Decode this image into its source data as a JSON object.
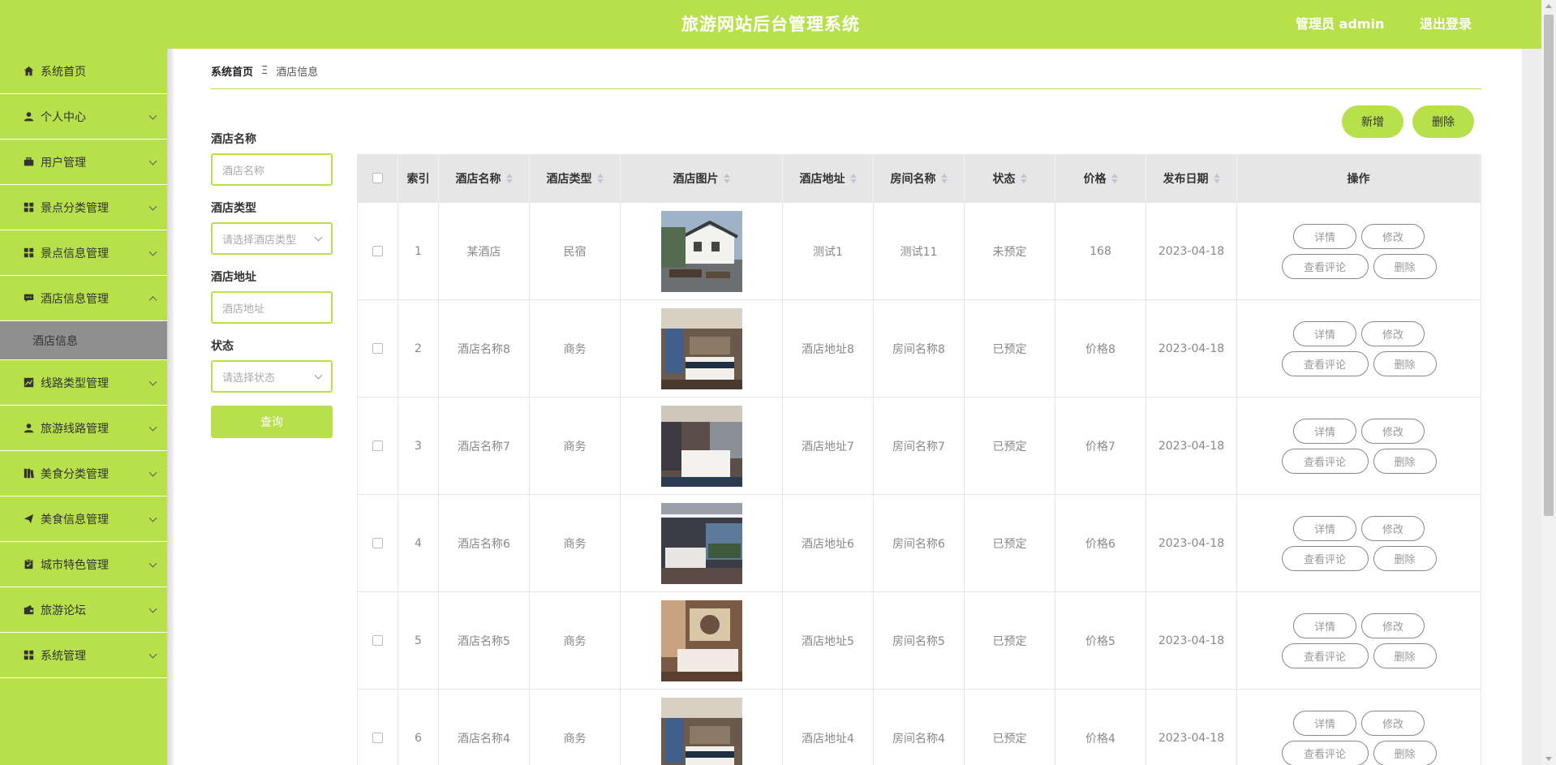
{
  "header": {
    "title": "旅游网站后台管理系统",
    "user": "管理员 admin",
    "logout": "退出登录"
  },
  "sidebar": {
    "items": [
      {
        "label": "系统首页",
        "icon": "home-icon"
      },
      {
        "label": "个人中心",
        "icon": "user-icon"
      },
      {
        "label": "用户管理",
        "icon": "briefcase-icon"
      },
      {
        "label": "景点分类管理",
        "icon": "grid-icon"
      },
      {
        "label": "景点信息管理",
        "icon": "grid-icon"
      },
      {
        "label": "酒店信息管理",
        "icon": "chat-icon"
      },
      {
        "label": "线路类型管理",
        "icon": "chart-icon"
      },
      {
        "label": "旅游线路管理",
        "icon": "user-icon"
      },
      {
        "label": "美食分类管理",
        "icon": "book-icon"
      },
      {
        "label": "美食信息管理",
        "icon": "send-icon"
      },
      {
        "label": "城市特色管理",
        "icon": "clipboard-icon"
      },
      {
        "label": "旅游论坛",
        "icon": "wallet-icon"
      },
      {
        "label": "系统管理",
        "icon": "grid-icon"
      }
    ],
    "submenu_label": "酒店信息"
  },
  "breadcrumb": {
    "home": "系统首页",
    "separator": "Ξ",
    "current": "酒店信息"
  },
  "actions": {
    "add": "新增",
    "delete": "删除"
  },
  "search": {
    "name_label": "酒店名称",
    "name_placeholder": "酒店名称",
    "type_label": "酒店类型",
    "type_placeholder": "请选择酒店类型",
    "address_label": "酒店地址",
    "address_placeholder": "酒店地址",
    "status_label": "状态",
    "status_placeholder": "请选择状态",
    "query": "查询"
  },
  "table": {
    "columns": [
      "索引",
      "酒店名称",
      "酒店类型",
      "酒店图片",
      "酒店地址",
      "房间名称",
      "状态",
      "价格",
      "发布日期",
      "操作"
    ],
    "rows": [
      {
        "index": "1",
        "name": "某酒店",
        "type": "民宿",
        "address": "测试1",
        "room": "测试11",
        "status": "未预定",
        "price": "168",
        "date": "2023-04-18"
      },
      {
        "index": "2",
        "name": "酒店名称8",
        "type": "商务",
        "address": "酒店地址8",
        "room": "房间名称8",
        "status": "已预定",
        "price": "价格8",
        "date": "2023-04-18"
      },
      {
        "index": "3",
        "name": "酒店名称7",
        "type": "商务",
        "address": "酒店地址7",
        "room": "房间名称7",
        "status": "已预定",
        "price": "价格7",
        "date": "2023-04-18"
      },
      {
        "index": "4",
        "name": "酒店名称6",
        "type": "商务",
        "address": "酒店地址6",
        "room": "房间名称6",
        "status": "已预定",
        "price": "价格6",
        "date": "2023-04-18"
      },
      {
        "index": "5",
        "name": "酒店名称5",
        "type": "商务",
        "address": "酒店地址5",
        "room": "房间名称5",
        "status": "已预定",
        "price": "价格5",
        "date": "2023-04-18"
      },
      {
        "index": "6",
        "name": "酒店名称4",
        "type": "商务",
        "address": "酒店地址4",
        "room": "房间名称4",
        "status": "已预定",
        "price": "价格4",
        "date": "2023-04-18"
      }
    ],
    "row_actions": {
      "detail": "详情",
      "edit": "修改",
      "comments": "查看评论",
      "delete": "删除"
    }
  },
  "colors": {
    "accent": "#b8e04b",
    "submenu_active": "#8f8f8f"
  }
}
